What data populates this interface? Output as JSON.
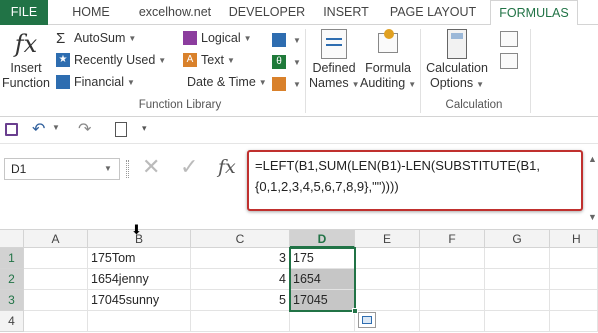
{
  "tabs": [
    "FILE",
    "HOME",
    "excelhow.net",
    "DEVELOPER",
    "INSERT",
    "PAGE LAYOUT",
    "FORMULAS"
  ],
  "ribbon": {
    "insert_function": {
      "line1": "Insert",
      "line2": "Function",
      "glyph": "fx"
    },
    "library": {
      "autosum": "AutoSum",
      "recently_used": "Recently Used",
      "financial": "Financial",
      "logical": "Logical",
      "text": "Text",
      "date_time": "Date & Time",
      "group_label": "Function Library"
    },
    "defined_names": {
      "line1": "Defined",
      "line2": "Names"
    },
    "formula_auditing": {
      "line1": "Formula",
      "line2": "Auditing"
    },
    "calculation": {
      "line1": "Calculation",
      "line2": "Options",
      "group_label": "Calculation"
    }
  },
  "formula_bar": {
    "name_box": "D1",
    "fx": "fx",
    "formula": "=LEFT(B1,SUM(LEN(B1)-LEN(SUBSTITUTE(B1,{0,1,2,3,4,5,6,7,8,9},\"\"))))"
  },
  "grid": {
    "columns": [
      "A",
      "B",
      "C",
      "D",
      "E",
      "F",
      "G",
      "H"
    ],
    "rows": [
      {
        "num": "1",
        "b": "175Tom",
        "c": "3",
        "d": "175"
      },
      {
        "num": "2",
        "b": "1654jenny",
        "c": "4",
        "d": "1654"
      },
      {
        "num": "3",
        "b": "17045sunny",
        "c": "5",
        "d": "17045"
      },
      {
        "num": "4",
        "b": "",
        "c": "",
        "d": ""
      }
    ]
  },
  "colors": {
    "accent": "#217346",
    "highlight_border": "#c0302e",
    "selection": "#c6c6c6"
  }
}
